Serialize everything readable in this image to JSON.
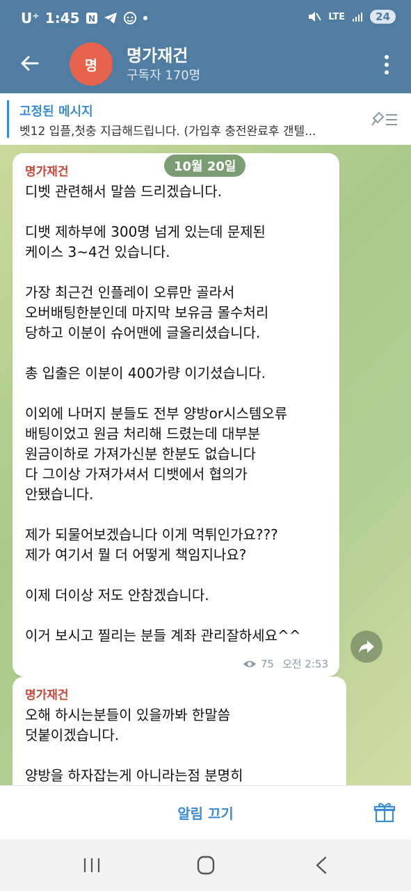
{
  "status_bar": {
    "carrier": "U⁺",
    "time": "1:45",
    "network": "LTE",
    "battery": "24"
  },
  "header": {
    "avatar_letter": "명",
    "title": "명가재건",
    "subtitle": "구독자 170명"
  },
  "pinned": {
    "title": "고정된 메시지",
    "text": "벳12 입플,첫충 지급해드립니다. (가입후 충전완료후 갠텔..."
  },
  "chat": {
    "date_chip": "10월 20일",
    "messages": [
      {
        "sender": "명가재건",
        "text": "디벳 관련해서 말씀 드리겠습니다.\n\n디뱃 제하부에 300명 넘게 있는데 문제된\n케이스 3~4건 있습니다.\n\n가장 최근건 인플레이 오류만 골라서\n오버배팅한분인데 마지막 보유금 몰수처리\n당하고 이분이 슈어맨에 글올리셨습니다.\n\n총 입출은 이분이 400가량 이기셨습니다.\n\n이외에 나머지 분들도 전부 양방or시스템오류\n배팅이었고 원금 처리해 드렸는데 대부분\n원금이하로 가져가신분 한분도 없습니다\n다 그이상 가져가셔서 디뱃에서 협의가\n안됐습니다.\n\n제가 되물어보겠습니다 이게 먹튀인가요???\n제가 여기서 뭘 더 어떻게 책임지나요?\n\n이제 더이상 저도 안참겠습니다.\n\n이거 보시고 찔리는 분들 계좌 관리잘하세요^^",
        "views": "75",
        "time": "오전 2:53"
      },
      {
        "sender": "명가재건",
        "text": "오해 하시는분들이 있을까봐 한말씀\n덧붙이겠습니다.\n\n양방을 하자잡는게 아니라는점 분명히"
      }
    ]
  },
  "bottom": {
    "mute_label": "알림 끄기"
  },
  "icons": {
    "back": "arrow-left-icon",
    "menu": "more-vertical-icon",
    "pin": "pin-list-icon",
    "share": "share-icon",
    "gift": "gift-icon",
    "views": "eye-icon"
  },
  "colors": {
    "header_bg": "#517da2",
    "accent": "#3a8bd6",
    "sender": "#c9473a",
    "avatar": "#e8634c"
  }
}
